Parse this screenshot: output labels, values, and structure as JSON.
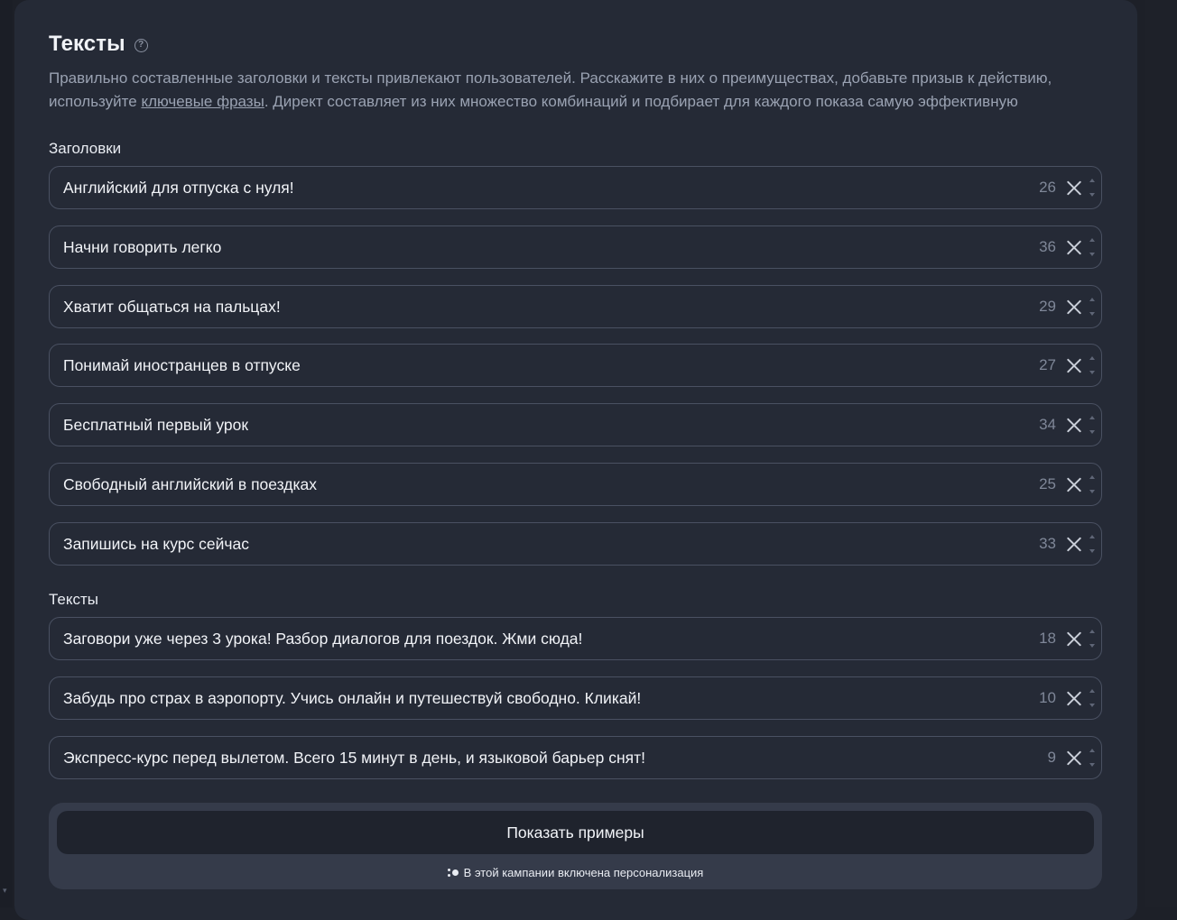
{
  "section": {
    "title": "Тексты",
    "help_icon": "question-circle-icon",
    "description_part1": "Правильно составленные заголовки и тексты привлекают пользователей. Расскажите в них о преимуществах, добавьте призыв к действию, используйте ",
    "description_link": "ключевые фразы",
    "description_part2": ". Директ составляет из них множество комбинаций и подбирает для каждого показа самую эффективную"
  },
  "headlines": {
    "label": "Заголовки",
    "items": [
      {
        "value": "Английский для отпуска с нуля!",
        "remaining": "26"
      },
      {
        "value": "Начни говорить легко",
        "remaining": "36"
      },
      {
        "value": "Хватит общаться на пальцах!",
        "remaining": "29"
      },
      {
        "value": "Понимай иностранцев в отпуске",
        "remaining": "27"
      },
      {
        "value": "Бесплатный первый урок",
        "remaining": "34"
      },
      {
        "value": "Свободный английский в поездках",
        "remaining": "25"
      },
      {
        "value": "Запишись на курс сейчас",
        "remaining": "33"
      }
    ]
  },
  "texts": {
    "label": "Тексты",
    "items": [
      {
        "value": "Заговори уже через 3 урока! Разбор диалогов для поездок. Жми сюда!",
        "remaining": "18"
      },
      {
        "value": "Забудь про страх в аэропорту. Учись онлайн и путешествуй свободно. Кликай!",
        "remaining": "10"
      },
      {
        "value": "Экспресс-курс перед вылетом. Всего 15 минут в день, и языковой барьер снят!",
        "remaining": "9"
      }
    ]
  },
  "examples": {
    "button_label": "Показать примеры",
    "personalization_text": "В этой кампании включена персонализация",
    "personalization_icon": "personalization-dots-icon"
  },
  "colors": {
    "panel_bg": "#252a36",
    "page_bg": "#1d2028",
    "field_border": "#4a5162",
    "muted_text": "#9aa2b2",
    "counter_text": "#7f8798"
  }
}
